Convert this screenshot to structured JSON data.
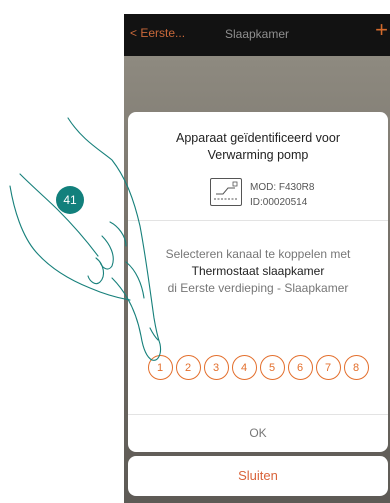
{
  "nav": {
    "back_label": "Eerste...",
    "title": "Slaapkamer",
    "add_label": "+"
  },
  "dialog": {
    "title_line1": "Apparaat geïdentificeerd voor",
    "title_line2": "Verwarming pomp",
    "device_mod": "MOD: F430R8",
    "device_id": "ID:00020514",
    "select_line1": "Selecteren kanaal te koppelen met",
    "select_line2": "Thermostaat slaapkamer",
    "select_line3": "di Eerste verdieping - Slaapkamer",
    "channels": [
      "1",
      "2",
      "3",
      "4",
      "5",
      "6",
      "7",
      "8"
    ],
    "ok_label": "OK"
  },
  "close_label": "Sluiten",
  "step_badge": "41",
  "colors": {
    "accent": "#e36f2d",
    "badge": "#12807c",
    "navbar": "#121212"
  }
}
